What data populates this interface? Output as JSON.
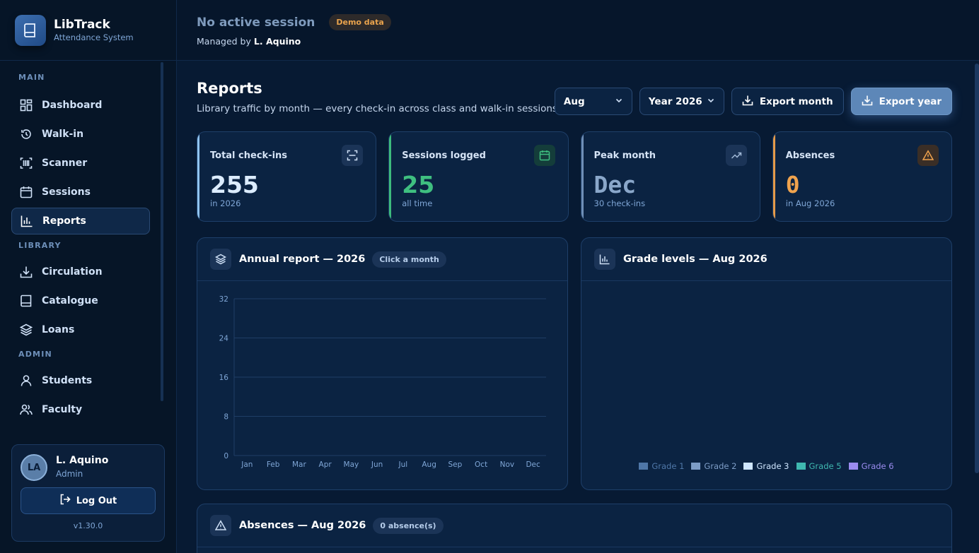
{
  "brand": {
    "title": "LibTrack",
    "subtitle": "Attendance System"
  },
  "nav": {
    "sections": {
      "main": "MAIN",
      "library": "LIBRARY",
      "admin": "ADMIN"
    },
    "items": {
      "dashboard": "Dashboard",
      "walkin": "Walk-in",
      "scanner": "Scanner",
      "sessions": "Sessions",
      "reports": "Reports",
      "circulation": "Circulation",
      "catalogue": "Catalogue",
      "loans": "Loans",
      "students": "Students",
      "faculty": "Faculty"
    },
    "active": "reports"
  },
  "user": {
    "initials": "LA",
    "name": "L. Aquino",
    "role": "Admin",
    "logout_label": "Log Out",
    "version": "v1.30.0"
  },
  "topbar": {
    "session_title": "No active session",
    "demo_badge": "Demo data",
    "managed_prefix": "Managed by",
    "managed_name": "L. Aquino"
  },
  "page": {
    "title": "Reports",
    "subtitle": "Library traffic by month — every check-in across class and walk-in sessions."
  },
  "controls": {
    "month": "Aug",
    "year": "Year 2026",
    "export_month": "Export month",
    "export_year": "Export year"
  },
  "stats": [
    {
      "label": "Total check-ins",
      "value": "255",
      "sub": "in 2026",
      "accent": "#8fc3ef",
      "value_color": "#dcecff"
    },
    {
      "label": "Sessions logged",
      "value": "25",
      "sub": "all time",
      "accent": "#3dbb7d",
      "value_color": "#3fbf80"
    },
    {
      "label": "Peak month",
      "value": "Dec",
      "sub": "30 check-ins",
      "accent": "#6f8fb7",
      "value_color": "#8aa7ca"
    },
    {
      "label": "Absences",
      "value": "0",
      "sub": "in Aug 2026",
      "accent": "#e59a48",
      "value_color": "#f0a34e"
    }
  ],
  "annual": {
    "title": "Annual report — 2026",
    "chip": "Click a month"
  },
  "grades": {
    "title": "Grade levels — Aug 2026"
  },
  "absences": {
    "title": "Absences — Aug 2026",
    "chip": "0 absence(s)"
  },
  "chart_data": [
    {
      "type": "bar",
      "title": "Annual report — 2026",
      "categories": [
        "Jan",
        "Feb",
        "Mar",
        "Apr",
        "May",
        "Jun",
        "Jul",
        "Aug",
        "Sep",
        "Oct",
        "Nov",
        "Dec"
      ],
      "values": [],
      "yticks": [
        0,
        8,
        16,
        24,
        32
      ],
      "ylim": [
        0,
        32
      ],
      "grid": true
    },
    {
      "type": "bar",
      "title": "Grade levels — Aug 2026",
      "series": [
        {
          "name": "Grade 1",
          "color": "#4f77a8"
        },
        {
          "name": "Grade 2",
          "color": "#7d9dc7"
        },
        {
          "name": "Grade 3",
          "color": "#cfe6ff"
        },
        {
          "name": "Grade 5",
          "color": "#3fb8b0"
        },
        {
          "name": "Grade 6",
          "color": "#9b8cf0"
        }
      ],
      "legend": "bottom"
    }
  ]
}
